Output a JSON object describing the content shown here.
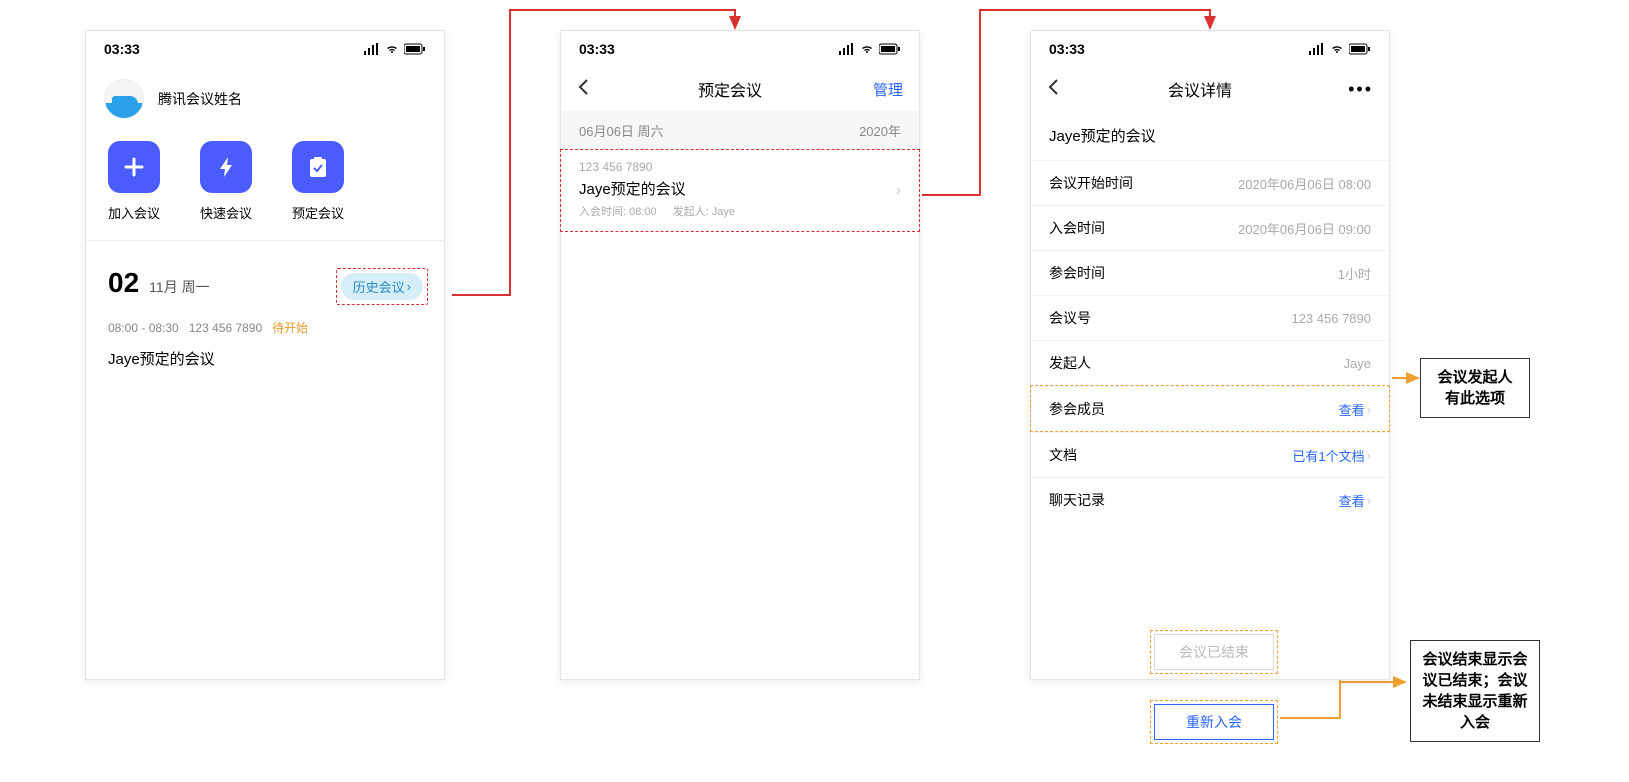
{
  "status": {
    "time": "03:33"
  },
  "phone1": {
    "userName": "腾讯会议姓名",
    "actions": {
      "join": "加入会议",
      "quick": "快速会议",
      "schedule": "预定会议"
    },
    "date": {
      "big": "02",
      "sub": "11月 周一"
    },
    "historyPill": "历史会议",
    "meeting": {
      "time": "08:00 - 08:30",
      "id": "123 456 7890",
      "status": "待开始",
      "title": "Jaye预定的会议"
    }
  },
  "phone2": {
    "navTitle": "预定会议",
    "navAction": "管理",
    "sectionDate": "06月06日  周六",
    "sectionYear": "2020年",
    "card": {
      "id": "123 456 7890",
      "title": "Jaye预定的会议",
      "joinTimeLabel": "入会时间:",
      "joinTime": "08:00",
      "hostLabel": "发起人:",
      "host": "Jaye"
    }
  },
  "phone3": {
    "navTitle": "会议详情",
    "title": "Jaye预定的会议",
    "rows": {
      "startLabel": "会议开始时间",
      "startVal": "2020年06月06日  08:00",
      "joinLabel": "入会时间",
      "joinVal": "2020年06月06日  09:00",
      "durationLabel": "参会时间",
      "durationVal": "1小时",
      "idLabel": "会议号",
      "idVal": "123 456 7890",
      "hostLabel": "发起人",
      "hostVal": "Jaye",
      "membersLabel": "参会成员",
      "membersLink": "查看",
      "docLabel": "文档",
      "docLink": "已有1个文档",
      "chatLabel": "聊天记录",
      "chatLink": "查看"
    },
    "btnEnded": "会议已结束",
    "btnRejoin": "重新入会"
  },
  "annotations": {
    "a1": "会议发起人有此选项",
    "a2": "会议结束显示会议已结束；会议未结束显示重新入会"
  }
}
